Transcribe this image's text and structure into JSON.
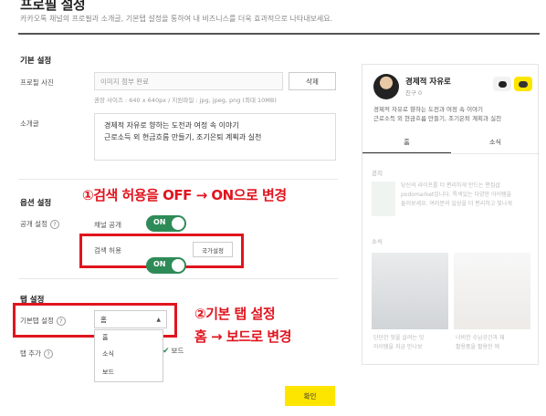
{
  "page": {
    "title": "프로필 설정",
    "description": "카카오톡 채널의 프로필과 소개글, 기본탭 설정을 통하여 내 비즈니스를 더욱 효과적으로 나타내보세요."
  },
  "basic": {
    "section_title": "기본 설정",
    "photo_label": "프로필 사진",
    "photo_value": "이미지 첨부 완료",
    "delete_button": "삭제",
    "photo_hint": "권장 사이즈 : 640 x 640px / 지원파일 : jpg, jpeg, png (최대 10MB)",
    "intro_label": "소개글",
    "intro_lines": [
      "경제적 자유로 향하는 도전과 여정 속 이야기",
      "근로소득 외 현금흐름 만들기, 조기은퇴 계획과 실천"
    ]
  },
  "options": {
    "section_title": "옵션 설정",
    "public_label": "공개 설정",
    "qmark": "?",
    "channel_public_label": "채널 공개",
    "channel_public_state": "ON",
    "search_label": "검색 허용",
    "search_state": "ON",
    "country_button": "국가설정"
  },
  "tabs": {
    "section_title": "탭 설정",
    "default_tab_label": "기본탭 설정",
    "default_tab_value": "홈",
    "dropdown_options": [
      "홈",
      "소식",
      "보드"
    ],
    "add_tab_label": "탭 추가",
    "add_tab_board": "보드"
  },
  "confirm_button": "확인",
  "annotations": {
    "one": "①검색 허용을 OFF → ON으로 변경",
    "two_line1": "②기본 탭 설정",
    "two_line2": "홈 → 보드로 변경"
  },
  "preview": {
    "name": "경제적 자유로",
    "friends": "친구 0",
    "desc_lines": [
      "경제적 자유로 향하는 도전과 여정 속 이야기",
      "근로소득 외 현금흐름 만들기, 조기은퇴 계획과 실천"
    ],
    "tab_home": "홈",
    "tab_news": "소식",
    "notice_label": "공지",
    "notice_lines": [
      "당신의 라이프를 더 편리하게 만드는 편집샵",
      "podomarket입니다. 특색있는 다양한 아이템을",
      "둘러보세요. 여러분의 일상을 더 편리하고 빛나게"
    ],
    "news_label": "소식",
    "card1_lines": [
      "단단한 멋을 살려는 잇",
      "아이템을 지금 만나보"
    ],
    "card2_lines": [
      "너비한 수납공간과 재",
      "활용품을 활용한 에"
    ],
    "colors": {
      "accent": "#fee500",
      "toggle": "#2e8b57",
      "annotation": "#e0141e"
    }
  }
}
